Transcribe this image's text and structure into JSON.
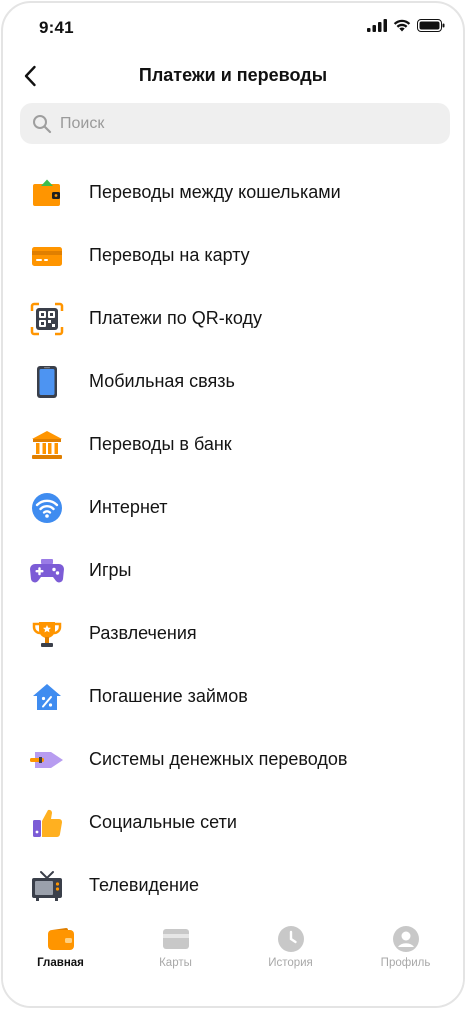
{
  "status": {
    "time": "9:41"
  },
  "header": {
    "title": "Платежи и переводы"
  },
  "search": {
    "placeholder": "Поиск"
  },
  "items": [
    {
      "label": "Переводы между кошельками",
      "icon": "wallet-icon"
    },
    {
      "label": "Переводы на карту",
      "icon": "card-icon"
    },
    {
      "label": "Платежи по QR-коду",
      "icon": "qr-code-icon"
    },
    {
      "label": "Мобильная связь",
      "icon": "smartphone-icon"
    },
    {
      "label": "Переводы в банк",
      "icon": "bank-icon"
    },
    {
      "label": "Интернет",
      "icon": "wifi-icon"
    },
    {
      "label": "Игры",
      "icon": "gamepad-icon"
    },
    {
      "label": "Развлечения",
      "icon": "trophy-icon"
    },
    {
      "label": "Погашение займов",
      "icon": "loan-house-icon"
    },
    {
      "label": "Системы денежных переводов",
      "icon": "money-transfer-icon"
    },
    {
      "label": "Социальные сети",
      "icon": "thumbs-up-icon"
    },
    {
      "label": "Телевидение",
      "icon": "tv-icon"
    }
  ],
  "tabs": [
    {
      "label": "Главная",
      "icon": "wallet-icon",
      "active": true
    },
    {
      "label": "Карты",
      "icon": "card-icon",
      "active": false
    },
    {
      "label": "История",
      "icon": "clock-icon",
      "active": false
    },
    {
      "label": "Профиль",
      "icon": "profile-icon",
      "active": false
    }
  ],
  "colors": {
    "accent": "#FF9500",
    "blue": "#3F8CF0",
    "purple": "#7C5CD6",
    "inactive": "#C8C8C8"
  }
}
